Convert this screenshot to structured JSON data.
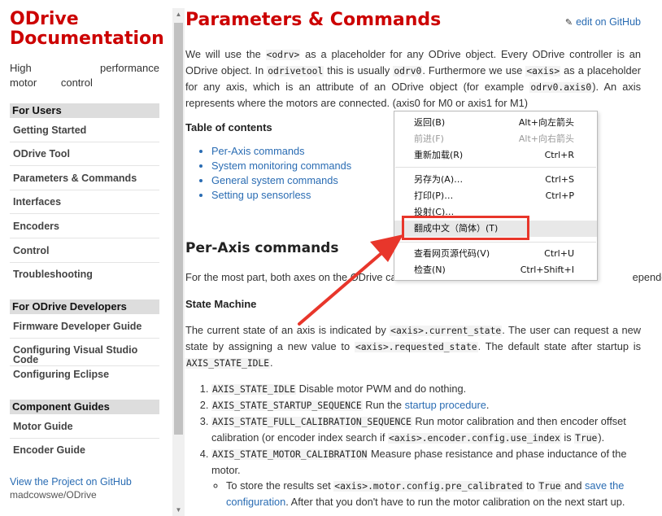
{
  "sidebar": {
    "site_title": "ODrive Documentation",
    "tagline": "High performance motor control",
    "sections": [
      {
        "header": "For Users",
        "items": [
          "Getting Started",
          "ODrive Tool",
          "Parameters & Commands",
          "Interfaces",
          "Encoders",
          "Control",
          "Troubleshooting"
        ]
      },
      {
        "header": "For ODrive Developers",
        "items": [
          "Firmware Developer Guide",
          "Configuring Visual Studio Code",
          "Configuring Eclipse"
        ]
      },
      {
        "header": "Component Guides",
        "items": [
          "Motor Guide",
          "Encoder Guide"
        ]
      }
    ],
    "github_link": "View the Project on GitHub",
    "github_repo": "madcowswe/ODrive"
  },
  "main": {
    "title": "Parameters & Commands",
    "edit_link": "edit on GitHub",
    "intro": {
      "p1": "We will use the ",
      "c1": "<odrv>",
      "p2": " as a placeholder for any ODrive object. Every ODrive controller is an ODrive object. In ",
      "c2": "odrivetool",
      "p3": " this is usually ",
      "c3": "odrv0",
      "p4": ". Furthermore we use ",
      "c4": "<axis>",
      "p5": " as a placeholder for any axis, which is an attribute of an ODrive object (for example ",
      "c5": "odrv0.axis0",
      "p6": "). An axis represents where the motors are connected. (axis0 for M0 or axis1 for M1)"
    },
    "toc_heading": "Table of contents",
    "toc": [
      "Per-Axis commands",
      "System monitoring commands",
      "General system commands",
      "Setting up sensorless"
    ],
    "h_per_axis": "Per-Axis commands",
    "per_axis_text": "For the most part, both axes on the ODrive ca",
    "per_axis_tail": "ependently.",
    "h_state_machine": "State Machine",
    "sm": {
      "p1": "The current state of an axis is indicated by ",
      "c1": "<axis>.current_state",
      "p2": ". The user can request a new state by assigning a new value to ",
      "c2": "<axis>.requested_state",
      "p3": ". The default state after startup is ",
      "c3": "AXIS_STATE_IDLE",
      "p4": "."
    },
    "states": [
      {
        "code": "AXIS_STATE_IDLE",
        "text": " Disable motor PWM and do nothing."
      },
      {
        "code": "AXIS_STATE_STARTUP_SEQUENCE",
        "text": " Run the ",
        "link": "startup procedure",
        "tail": "."
      },
      {
        "code": "AXIS_STATE_FULL_CALIBRATION_SEQUENCE",
        "text": " Run motor calibration and then encoder offset calibration (or encoder index search if ",
        "code2": "<axis>.encoder.config.use_index",
        "mid": " is ",
        "code3": "True",
        "tail": ")."
      },
      {
        "code": "AXIS_STATE_MOTOR_CALIBRATION",
        "text": " Measure phase resistance and phase inductance of the motor."
      }
    ],
    "sub": {
      "p1": "To store the results set ",
      "c1": "<axis>.motor.config.pre_calibrated",
      "p2": " to ",
      "c2": "True",
      "p3": " and ",
      "link": "save the configuration",
      "p4": ". After that you don't have to run the motor calibration on the next start up."
    }
  },
  "context_menu": {
    "items": [
      {
        "label": "返回(B)",
        "shortcut": "Alt+向左箭头",
        "enabled": true
      },
      {
        "label": "前进(F)",
        "shortcut": "Alt+向右箭头",
        "enabled": false
      },
      {
        "label": "重新加载(R)",
        "shortcut": "Ctrl+R",
        "enabled": true
      },
      {
        "label": "另存为(A)…",
        "shortcut": "Ctrl+S",
        "enabled": true
      },
      {
        "label": "打印(P)…",
        "shortcut": "Ctrl+P",
        "enabled": true
      },
      {
        "label": "投射(C)…",
        "shortcut": "",
        "enabled": true
      },
      {
        "label": "翻成中文（简体）(T)",
        "shortcut": "",
        "enabled": true,
        "highlighted": true
      },
      {
        "label": "查看网页源代码(V)",
        "shortcut": "Ctrl+U",
        "enabled": true
      },
      {
        "label": "检查(N)",
        "shortcut": "Ctrl+Shift+I",
        "enabled": true
      }
    ]
  },
  "colors": {
    "brand_red": "#cc0000",
    "link": "#2a6cb3",
    "annotation_red": "#e8362b"
  }
}
